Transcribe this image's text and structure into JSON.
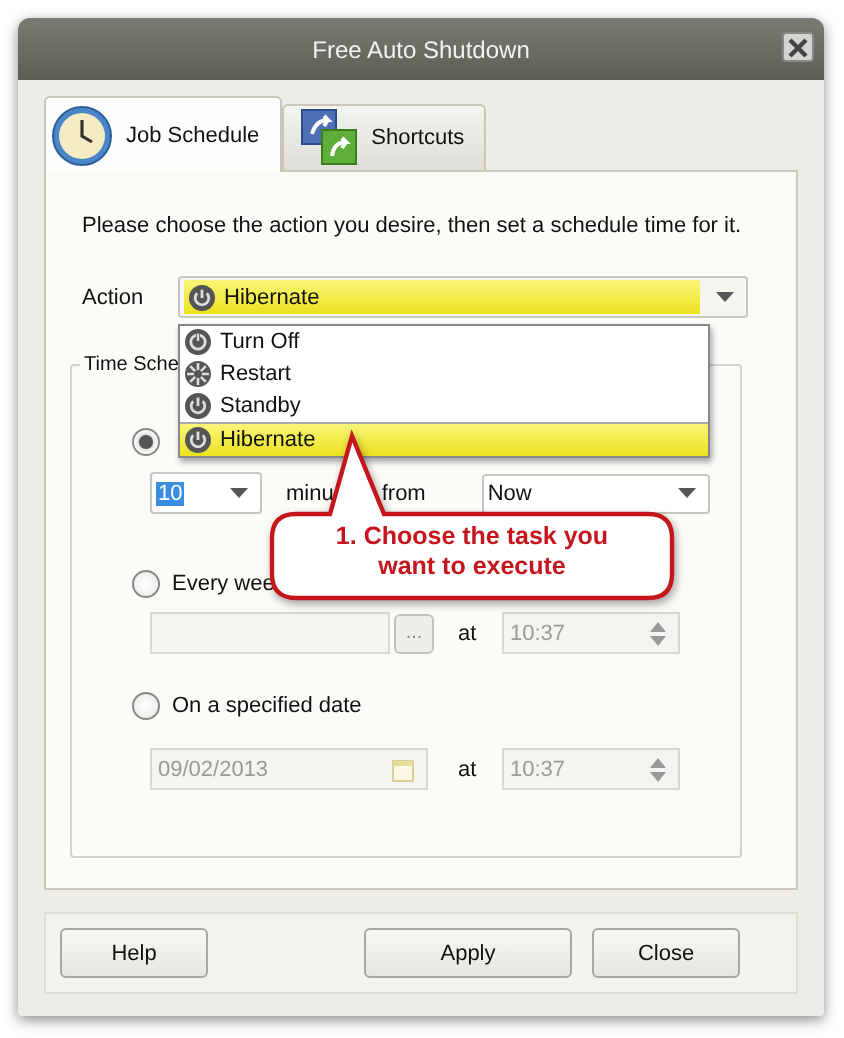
{
  "window": {
    "title": "Free Auto Shutdown"
  },
  "tabs": [
    {
      "label": "Job Schedule",
      "selected": true
    },
    {
      "label": "Shortcuts",
      "selected": false
    }
  ],
  "instruction": "Please choose the action you desire, then set a schedule time for it.",
  "action": {
    "label": "Action",
    "value": "Hibernate"
  },
  "action_list": [
    {
      "label": "Turn Off",
      "selected": false
    },
    {
      "label": "Restart",
      "selected": false
    },
    {
      "label": "Standby",
      "selected": false
    },
    {
      "label": "Hibernate",
      "selected": true
    }
  ],
  "time_schedule": {
    "title": "Time Sche",
    "options": [
      {
        "kind": "relative",
        "selected": true,
        "disabled": false,
        "amount": "10",
        "unit_label": "minu",
        "from_label": "from",
        "from_value": "Now"
      },
      {
        "kind": "weekly",
        "label": "Every wee",
        "selected": false,
        "disabled": true,
        "browse": "...",
        "at_label": "at",
        "time": "10:37"
      },
      {
        "kind": "date",
        "label": "On a specified date",
        "selected": false,
        "disabled": true,
        "date": "09/02/2013",
        "at_label": "at",
        "time": "10:37"
      }
    ]
  },
  "callout": "1. Choose the task you want to execute",
  "buttons": [
    {
      "label": "Help"
    },
    {
      "label": "Apply"
    },
    {
      "label": "Close"
    }
  ]
}
